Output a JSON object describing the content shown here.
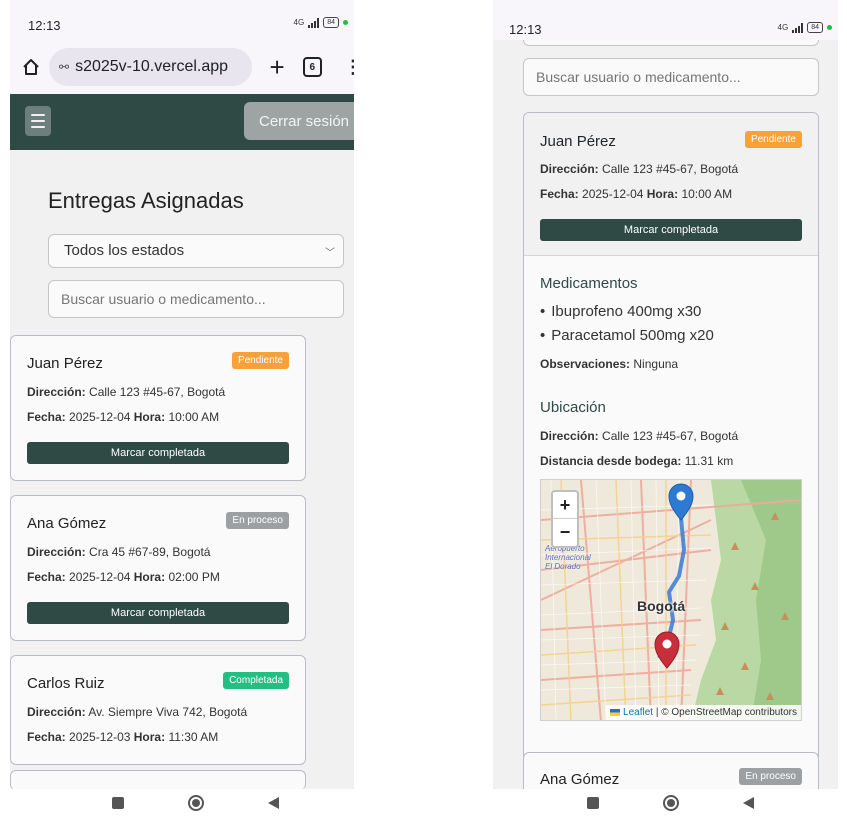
{
  "status": {
    "time": "12:13",
    "network": "4G",
    "battery": "84"
  },
  "browser": {
    "url": "s2025v-10.vercel.app",
    "tab_count": "6"
  },
  "navbar": {
    "logout_label": "Cerrar sesión"
  },
  "page": {
    "title": "Entregas Asignadas",
    "filter_value": "Todos los estados",
    "search_placeholder": "Buscar usuario o medicamento..."
  },
  "labels": {
    "address": "Dirección:",
    "date": "Fecha:",
    "hour": "Hora:",
    "mark_completed": "Marcar completada",
    "medications": "Medicamentos",
    "observations": "Observaciones:",
    "location": "Ubicación",
    "distance": "Distancia desde bodega:"
  },
  "deliveries": [
    {
      "name": "Juan Pérez",
      "status": "Pendiente",
      "address": "Calle 123 #45-67, Bogotá",
      "date": "2025-12-04",
      "hour": "10:00 AM"
    },
    {
      "name": "Ana Gómez",
      "status": "En proceso",
      "address": "Cra 45 #67-89, Bogotá",
      "date": "2025-12-04",
      "hour": "02:00 PM"
    },
    {
      "name": "Carlos Ruiz",
      "status": "Completada",
      "address": "Av. Siempre Viva 742, Bogotá",
      "date": "2025-12-03",
      "hour": "11:30 AM"
    }
  ],
  "detail": {
    "medications": [
      "Ibuprofeno 400mg x30",
      "Paracetamol 500mg x20"
    ],
    "observations": "Ninguna",
    "distance": "11.31 km"
  },
  "map": {
    "zoom_in": "+",
    "zoom_out": "−",
    "city_label": "Bogotá",
    "airport_line1": "Aeropuerto",
    "airport_line2": "Internacional",
    "airport_line3": "El Dorado",
    "attribution_leaflet": "Leaflet",
    "attribution_rest": "| © OpenStreetMap contributors"
  },
  "colors": {
    "primary": "#2f4a45",
    "pending": "#f7a138",
    "in_process": "#9da0a3",
    "completed": "#21bf82"
  }
}
